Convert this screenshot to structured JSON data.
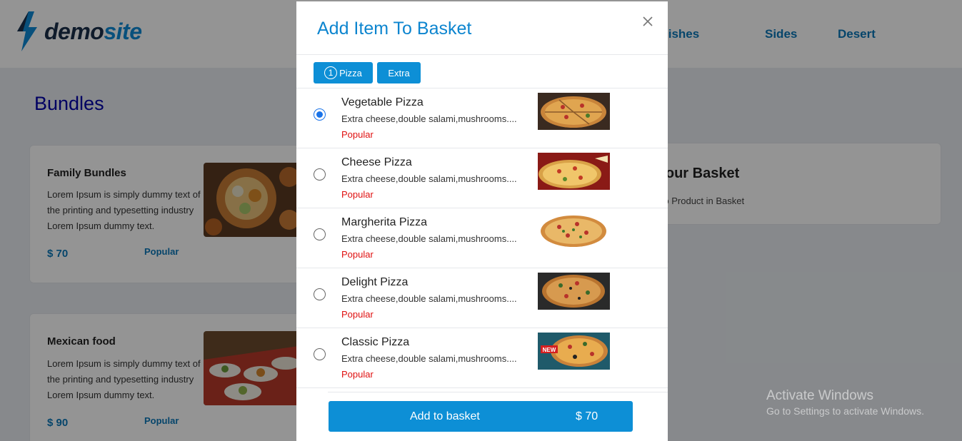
{
  "brand": {
    "name_part1": "demo",
    "name_part2": "site"
  },
  "nav": {
    "items": [
      "Main Dishes",
      "Sides",
      "Desert"
    ]
  },
  "bundles": {
    "title": "Bundles",
    "cards": [
      {
        "title": "Family Bundles",
        "description": "Lorem Ipsum is simply dummy text of the printing and typesetting industry Lorem Ipsum dummy text.",
        "price": "$ 70",
        "tag": "Popular"
      },
      {
        "title": "Mexican food",
        "description": "Lorem Ipsum is simply dummy text of the printing and typesetting industry Lorem Ipsum dummy text.",
        "price": "$ 90",
        "tag": "Popular"
      }
    ]
  },
  "basket": {
    "title": "Your Basket",
    "empty_text": "No Product in Basket"
  },
  "windows_watermark": {
    "line1": "Activate Windows",
    "line2": "Go to Settings to activate Windows."
  },
  "modal": {
    "title": "Add Item To Basket",
    "tabs": [
      {
        "number": "1",
        "label": "Pizza"
      },
      {
        "label": "Extra"
      }
    ],
    "items": [
      {
        "name": "Vegetable Pizza",
        "description": "Extra cheese,double salami,mushrooms....",
        "tag": "Popular",
        "selected": true
      },
      {
        "name": "Cheese Pizza",
        "description": "Extra cheese,double salami,mushrooms....",
        "tag": "Popular",
        "selected": false
      },
      {
        "name": "Margherita Pizza",
        "description": "Extra cheese,double salami,mushrooms....",
        "tag": "Popular",
        "selected": false
      },
      {
        "name": "Delight Pizza",
        "description": "Extra cheese,double salami,mushrooms....",
        "tag": "Popular",
        "selected": false
      },
      {
        "name": "Classic Pizza",
        "description": "Extra cheese,double salami,mushrooms....",
        "tag": "Popular",
        "selected": false
      }
    ],
    "add_button": {
      "label": "Add to basket",
      "price": "$ 70"
    },
    "new_badge": "NEW"
  },
  "colors": {
    "accent": "#0d8fd6",
    "nav_link": "#0b78b8",
    "popular_red": "#e01010",
    "title_blue": "#0000aa"
  }
}
